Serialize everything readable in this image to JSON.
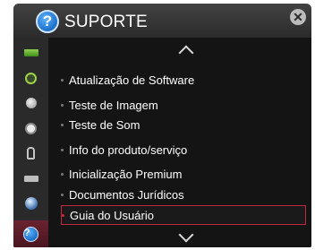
{
  "header": {
    "title": "SUPORTE",
    "help_icon": "help-question-icon",
    "close_icon": "close-icon",
    "help_glyph": "?",
    "close_glyph": "✕"
  },
  "sidebar": {
    "items": [
      {
        "icon": "picture-icon"
      },
      {
        "icon": "sound-icon"
      },
      {
        "icon": "channel-icon"
      },
      {
        "icon": "time-icon"
      },
      {
        "icon": "lock-icon"
      },
      {
        "icon": "option-icon"
      },
      {
        "icon": "network-icon"
      },
      {
        "icon": "support-icon",
        "active": true,
        "glyph": "?"
      }
    ]
  },
  "menu": {
    "items": [
      "Atualização de Software",
      "Teste de Imagem",
      "Teste de Som",
      "Info do produto/serviço",
      "Inicialização Premium",
      "Documentos Jurídicos",
      "Guia do Usuário"
    ],
    "selected_index": 6
  },
  "colors": {
    "accent": "#c4283f",
    "background": "#141414",
    "header": "#3a3a3a"
  }
}
